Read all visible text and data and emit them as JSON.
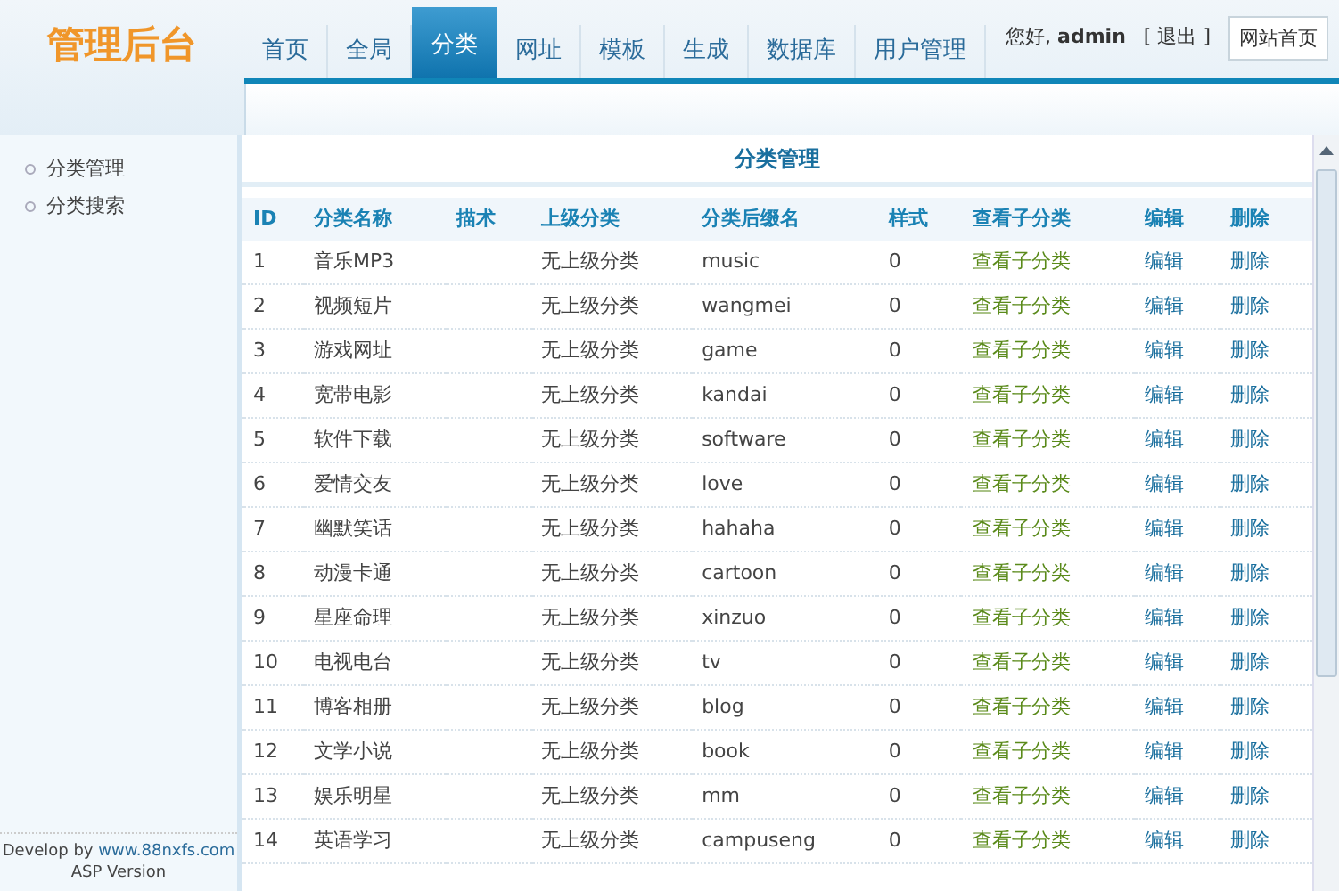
{
  "header": {
    "logo": "管理后台",
    "tabs": [
      {
        "label": "首页",
        "selected": false
      },
      {
        "label": "全局",
        "selected": false
      },
      {
        "label": "分类",
        "selected": true
      },
      {
        "label": "网址",
        "selected": false
      },
      {
        "label": "模板",
        "selected": false
      },
      {
        "label": "生成",
        "selected": false
      },
      {
        "label": "数据库",
        "selected": false
      },
      {
        "label": "用户管理",
        "selected": false
      }
    ],
    "greeting": "您好, **admin**",
    "logout": "[ 退出 ]",
    "home_button": "网站首页"
  },
  "sidebar": {
    "items": [
      "分类管理",
      "分类搜索"
    ],
    "footer_prefix": "Develop by",
    "footer_link": "www.88nxfs.com",
    "footer_version": "ASP Version"
  },
  "panel": {
    "title": "分类管理",
    "columns": [
      "ID",
      "分类名称",
      "描术",
      "上级分类",
      "分类后缀名",
      "样式",
      "查看子分类",
      "编辑",
      "删除"
    ],
    "rows": [
      [
        "1",
        "音乐MP3",
        "",
        "无上级分类",
        "music",
        "0",
        "查看子分类",
        "编辑",
        "删除"
      ],
      [
        "2",
        "视频短片",
        "",
        "无上级分类",
        "wangmei",
        "0",
        "查看子分类",
        "编辑",
        "删除"
      ],
      [
        "3",
        "游戏网址",
        "",
        "无上级分类",
        "game",
        "0",
        "查看子分类",
        "编辑",
        "删除"
      ],
      [
        "4",
        "宽带电影",
        "",
        "无上级分类",
        "kandai",
        "0",
        "查看子分类",
        "编辑",
        "删除"
      ],
      [
        "5",
        "软件下载",
        "",
        "无上级分类",
        "software",
        "0",
        "查看子分类",
        "编辑",
        "删除"
      ],
      [
        "6",
        "爱情交友",
        "",
        "无上级分类",
        "love",
        "0",
        "查看子分类",
        "编辑",
        "删除"
      ],
      [
        "7",
        "幽默笑话",
        "",
        "无上级分类",
        "hahaha",
        "0",
        "查看子分类",
        "编辑",
        "删除"
      ],
      [
        "8",
        "动漫卡通",
        "",
        "无上级分类",
        "cartoon",
        "0",
        "查看子分类",
        "编辑",
        "删除"
      ],
      [
        "9",
        "星座命理",
        "",
        "无上级分类",
        "xinzuo",
        "0",
        "查看子分类",
        "编辑",
        "删除"
      ],
      [
        "10",
        "电视电台",
        "",
        "无上级分类",
        "tv",
        "0",
        "查看子分类",
        "编辑",
        "删除"
      ],
      [
        "11",
        "博客相册",
        "",
        "无上级分类",
        "blog",
        "0",
        "查看子分类",
        "编辑",
        "删除"
      ],
      [
        "12",
        "文学小说",
        "",
        "无上级分类",
        "book",
        "0",
        "查看子分类",
        "编辑",
        "删除"
      ],
      [
        "13",
        "娱乐明星",
        "",
        "无上级分类",
        "mm",
        "0",
        "查看子分类",
        "编辑",
        "删除"
      ],
      [
        "14",
        "英语学习",
        "",
        "无上级分类",
        "campuseng",
        "0",
        "查看子分类",
        "编辑",
        "删除"
      ]
    ]
  }
}
